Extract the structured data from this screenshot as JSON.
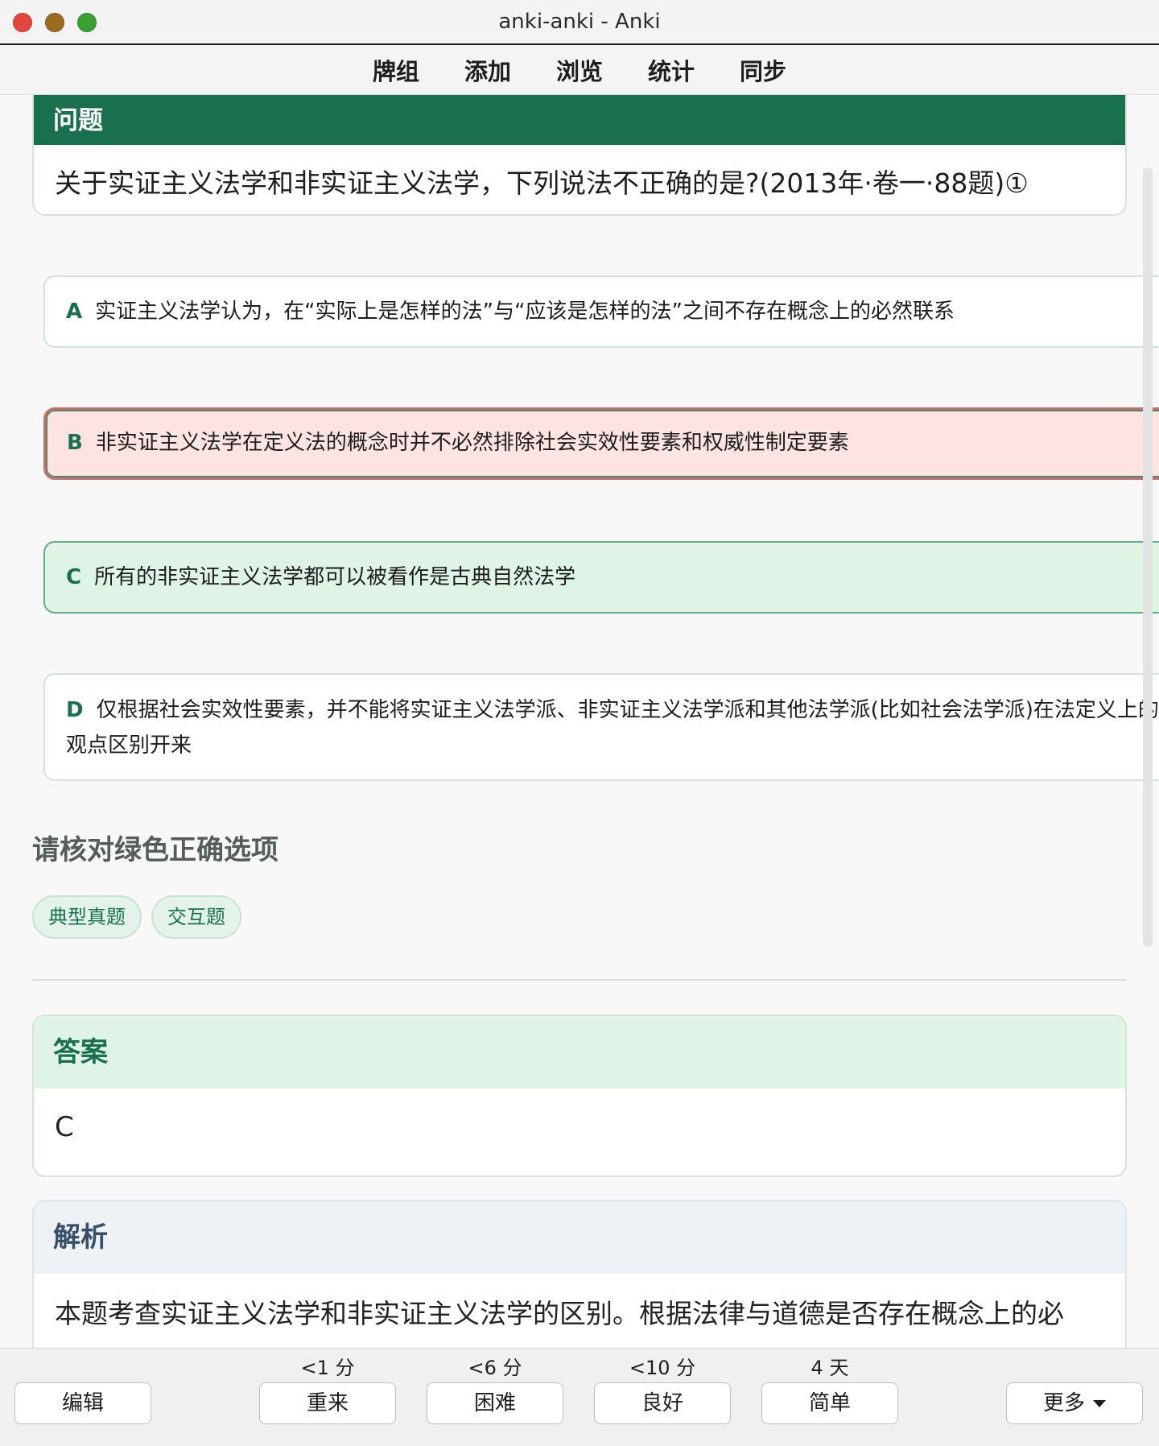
{
  "window": {
    "title": "anki-anki - Anki"
  },
  "toolbar": {
    "items": [
      "牌组",
      "添加",
      "浏览",
      "统计",
      "同步"
    ]
  },
  "question": {
    "header": "问题",
    "text": "关于实证主义法学和非实证主义法学，下列说法不正确的是?(2013年·卷一·88题)①"
  },
  "options": [
    {
      "letter": "A",
      "text": "实证主义法学认为，在“实际上是怎样的法”与“应该是怎样的法”之间不存在概念上的必然联系",
      "state": "normal"
    },
    {
      "letter": "B",
      "text": "非实证主义法学在定义法的概念时并不必然排除社会实效性要素和权威性制定要素",
      "state": "selected-wrong"
    },
    {
      "letter": "C",
      "text": "所有的非实证主义法学都可以被看作是古典自然法学",
      "state": "correct"
    },
    {
      "letter": "D",
      "text_line1": "仅根据社会实效性要素，并不能将实证主义法学派、非实证主义法学派和其他法学派(比如社会法学派)在法定义上的",
      "text_line2": "观点区别开来",
      "state": "normal"
    }
  ],
  "hint": "请核对绿色正确选项",
  "tags": [
    "典型真题",
    "交互题"
  ],
  "answer": {
    "header": "答案",
    "value": "C"
  },
  "analysis": {
    "header": "解析",
    "text": "本题考查实证主义法学和非实证主义法学的区别。根据法律与道德是否存在概念上的必"
  },
  "bottom": {
    "edit": "编辑",
    "more": "更多",
    "answers": [
      {
        "label": "重来",
        "interval": "<1 分"
      },
      {
        "label": "困难",
        "interval": "<6 分"
      },
      {
        "label": "良好",
        "interval": "<10 分"
      },
      {
        "label": "简单",
        "interval": "4 天"
      }
    ]
  },
  "colors": {
    "accent": "#18704f",
    "correct_bg": "#dff3e7",
    "wrong_bg": "#fde4e3",
    "analysis_head": "#eef2f6"
  }
}
